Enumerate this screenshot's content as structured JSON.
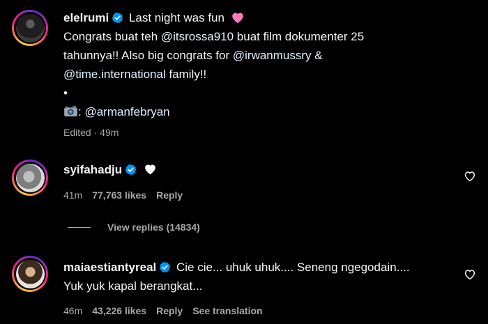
{
  "post": {
    "username": "elelrumi",
    "lines": [
      [
        "Last night was fun"
      ],
      [
        "Congrats buat teh ",
        "@itsrossa910",
        " buat film dokumenter 25"
      ],
      [
        "tahunnya!! Also big congrats for ",
        "@irwanmussry",
        " &"
      ],
      [
        "@time.international",
        " family!!"
      ],
      [
        "•"
      ],
      [
        ": ",
        "@armanfebryan"
      ]
    ],
    "edited": "Edited",
    "separator": "·",
    "time": "49m"
  },
  "comments": [
    {
      "username": "syifahadju",
      "time": "41m",
      "likes": "77,763 likes",
      "reply": "Reply"
    },
    {
      "username": "maiaestiantyreal",
      "text_line1": "Cie cie... uhuk uhuk.... Seneng ngegodain....",
      "text_line2": "Yuk yuk kapal berangkat...",
      "time": "46m",
      "likes": "43,226 likes",
      "reply": "Reply",
      "translation": "See translation"
    }
  ],
  "view_replies": "View replies (14834)",
  "icons": {
    "verified": "verified-badge-icon",
    "pink_heart": "pink-heart-emoji-icon",
    "white_heart": "white-heart-emoji-icon",
    "camera": "camera-emoji-icon",
    "like": "heart-outline-icon"
  },
  "colors": {
    "background": "#000000",
    "text": "#f5f5f5",
    "secondary": "#a8a8a8",
    "mention": "#e0f1ff",
    "verified": "#0095f6",
    "pink_heart": "#ff7ab8"
  }
}
